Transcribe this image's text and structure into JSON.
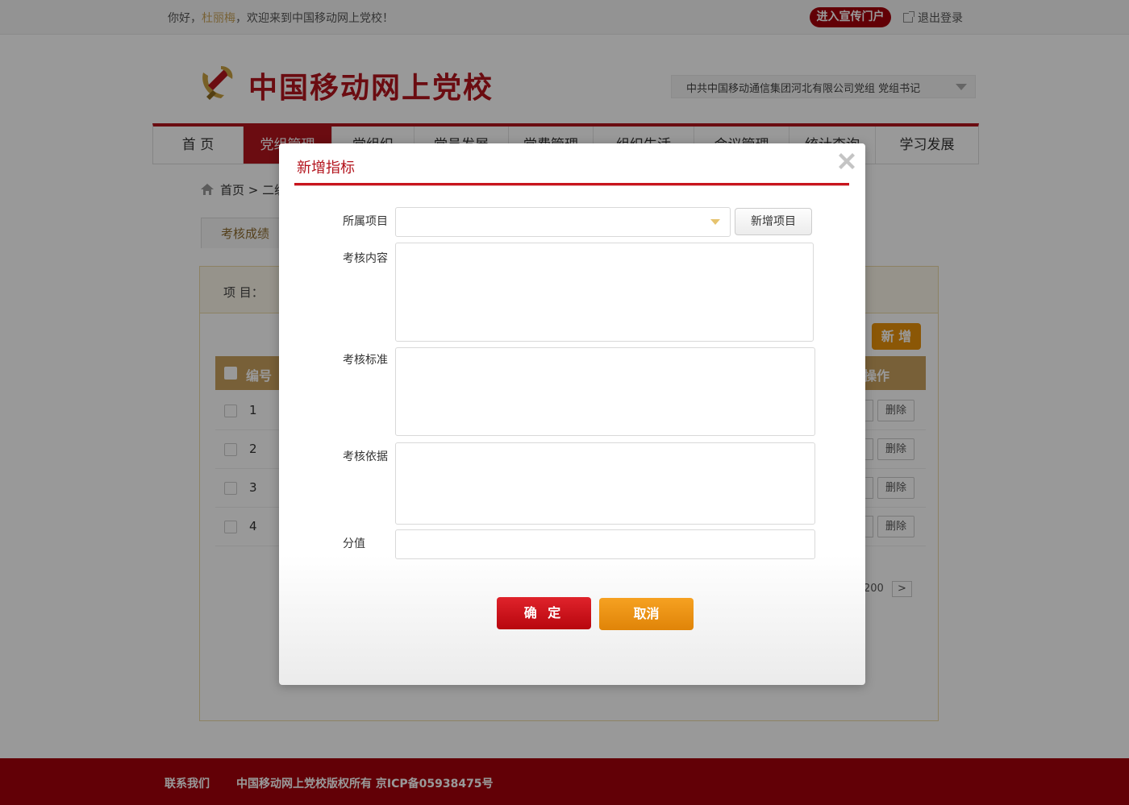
{
  "topbar": {
    "greet_prefix": "你好，",
    "user_name": "杜丽梅",
    "greet_suffix": "，欢迎来到中国移动网上党校！",
    "portal_button": "进入宣传门户",
    "logout": "退出登录"
  },
  "header": {
    "site_title": "中国移动网上党校",
    "org_selector": "中共中国移动通信集团河北有限公司党组   党组书记"
  },
  "nav": {
    "items": [
      {
        "label": "首  页"
      },
      {
        "label": "党组管理"
      },
      {
        "label": "党组织"
      },
      {
        "label": "党员发展"
      },
      {
        "label": "党费管理"
      },
      {
        "label": "组织生活"
      },
      {
        "label": "会议管理"
      },
      {
        "label": "统计查询"
      },
      {
        "label": "学习发展"
      }
    ]
  },
  "breadcrumb": {
    "home": "首页",
    "sep": ">",
    "next": "二级"
  },
  "subtab": "考核成绩",
  "panel": {
    "filter_label": "项 目：",
    "add_button": "新 增",
    "columns": {
      "id": "编号",
      "op": "操作"
    },
    "rows": [
      {
        "num": "1",
        "delete": "删除"
      },
      {
        "num": "2",
        "delete": "删除"
      },
      {
        "num": "3",
        "delete": "删除"
      },
      {
        "num": "4",
        "delete": "删除"
      }
    ],
    "pager": {
      "last": "200",
      "next": ">"
    }
  },
  "footer": {
    "contact": "联系我们",
    "copyright": "中国移动网上党校版权所有  京ICP备05938475号"
  },
  "modal": {
    "title": "新增指标",
    "fields": {
      "project_label": "所属项目",
      "project_value": "",
      "add_project_button": "新增项目",
      "content_label": "考核内容",
      "content_value": "",
      "standard_label": "考核标准",
      "standard_value": "",
      "basis_label": "考核依据",
      "basis_value": "",
      "score_label": "分值",
      "score_value": ""
    },
    "confirm_button": "确 定",
    "cancel_button": "取消"
  },
  "colors": {
    "brand_red": "#b3141d",
    "footer_red": "#a3000a",
    "gold": "#c9a05e",
    "orange": "#e8920b"
  }
}
